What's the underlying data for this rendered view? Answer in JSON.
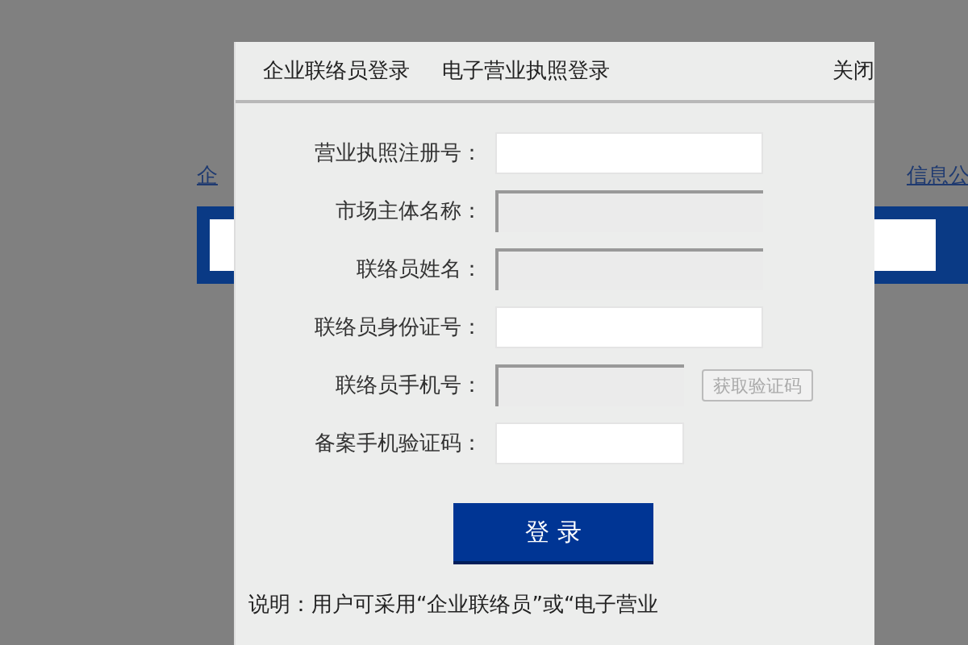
{
  "background_page": {
    "nav_links": [
      "企",
      "信息公"
    ]
  },
  "dialog": {
    "tabs": [
      "企业联络员登录",
      "电子营业执照登录"
    ],
    "close": "关闭",
    "fields": [
      {
        "label": "营业执照注册号：",
        "disabled": false,
        "short": false
      },
      {
        "label": "市场主体名称：",
        "disabled": true,
        "short": false
      },
      {
        "label": "联络员姓名：",
        "disabled": true,
        "short": false
      },
      {
        "label": "联络员身份证号：",
        "disabled": false,
        "short": false
      },
      {
        "label": "联络员手机号：",
        "disabled": true,
        "short": true,
        "button": {
          "label": "获取验证码",
          "disabled": true
        }
      },
      {
        "label": "备案手机验证码：",
        "disabled": false,
        "short": true
      }
    ],
    "login_button": "登 录",
    "note": "说明：用户可采用“企业联络员”或“电子营业"
  }
}
